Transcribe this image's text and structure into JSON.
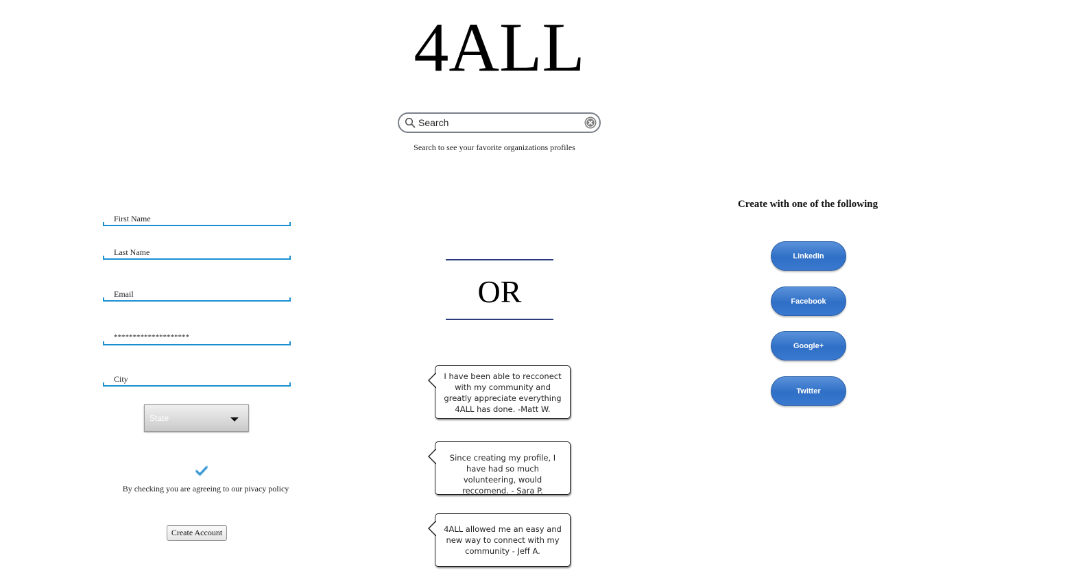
{
  "header": {
    "logo_text": "4ALL"
  },
  "search": {
    "placeholder": "Search",
    "helper_text": "Search to see your favorite organizations profiles",
    "search_icon": "search-icon",
    "clear_icon": "clear-icon"
  },
  "form": {
    "first_name_label": "First Name",
    "last_name_label": "Last Name",
    "email_label": "Email",
    "password_mask": "********************",
    "city_label": "City",
    "state_select_value": "State",
    "privacy_checkbox_checked": true,
    "privacy_text": "By checking you are agreeing to our pivacy policy",
    "create_account_label": "Create Account",
    "accent_color": "#1a8fd0"
  },
  "divider": {
    "or_text": "OR",
    "rule_color": "#2a3a7c"
  },
  "testimonials": [
    {
      "text": "I have been able to recconect with my community and greatly appreciate everything 4ALL has done. -Matt W."
    },
    {
      "text": "Since creating my profile, I have had so much volunteering, would reccomend. - Sara P."
    },
    {
      "text": "4ALL allowed me an easy and new way to connect with my community - Jeff A."
    }
  ],
  "social": {
    "heading": "Create with one of the following",
    "buttons": [
      {
        "label": "LinkedIn"
      },
      {
        "label": "Facebook"
      },
      {
        "label": "Google+"
      },
      {
        "label": "Twitter"
      }
    ],
    "button_color": "#3a79cf"
  }
}
